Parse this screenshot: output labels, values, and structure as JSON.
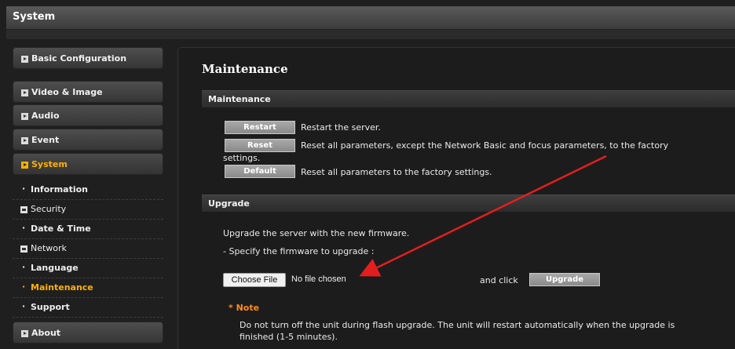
{
  "header": {
    "title": "System"
  },
  "sidebar": {
    "items": [
      {
        "label": "Basic Configuration"
      },
      {
        "label": "Video & Image"
      },
      {
        "label": "Audio"
      },
      {
        "label": "Event"
      },
      {
        "label": "System"
      },
      {
        "label": "About"
      }
    ],
    "sub_items": [
      {
        "label": "Information"
      },
      {
        "label": "Security"
      },
      {
        "label": "Date & Time"
      },
      {
        "label": "Network"
      },
      {
        "label": "Language"
      },
      {
        "label": "Maintenance"
      },
      {
        "label": "Support"
      }
    ]
  },
  "main": {
    "title": "Maintenance",
    "maintenance_section": {
      "heading": "Maintenance",
      "restart_label": "Restart",
      "restart_desc": "Restart the server.",
      "reset_label": "Reset",
      "reset_desc_line1": "Reset all parameters, except the Network Basic and focus parameters, to the factory",
      "reset_desc_line2": "settings.",
      "default_label": "Default",
      "default_desc": "Reset all parameters to the factory settings."
    },
    "upgrade_section": {
      "heading": "Upgrade",
      "intro": "Upgrade the server with the new firmware.",
      "specify": "- Specify the firmware to upgrade :",
      "choose_file_label": "Choose File",
      "no_file_text": "No file chosen",
      "and_click": "and click",
      "upgrade_label": "Upgrade",
      "note_title": "* Note",
      "note_text": "Do not turn off the unit during flash upgrade. The unit will restart automatically when the upgrade is finished (1-5 minutes)."
    }
  },
  "colors": {
    "accent": "#ffb100",
    "note": "#ff8a1e",
    "annotation_arrow": "#e41e1e"
  }
}
